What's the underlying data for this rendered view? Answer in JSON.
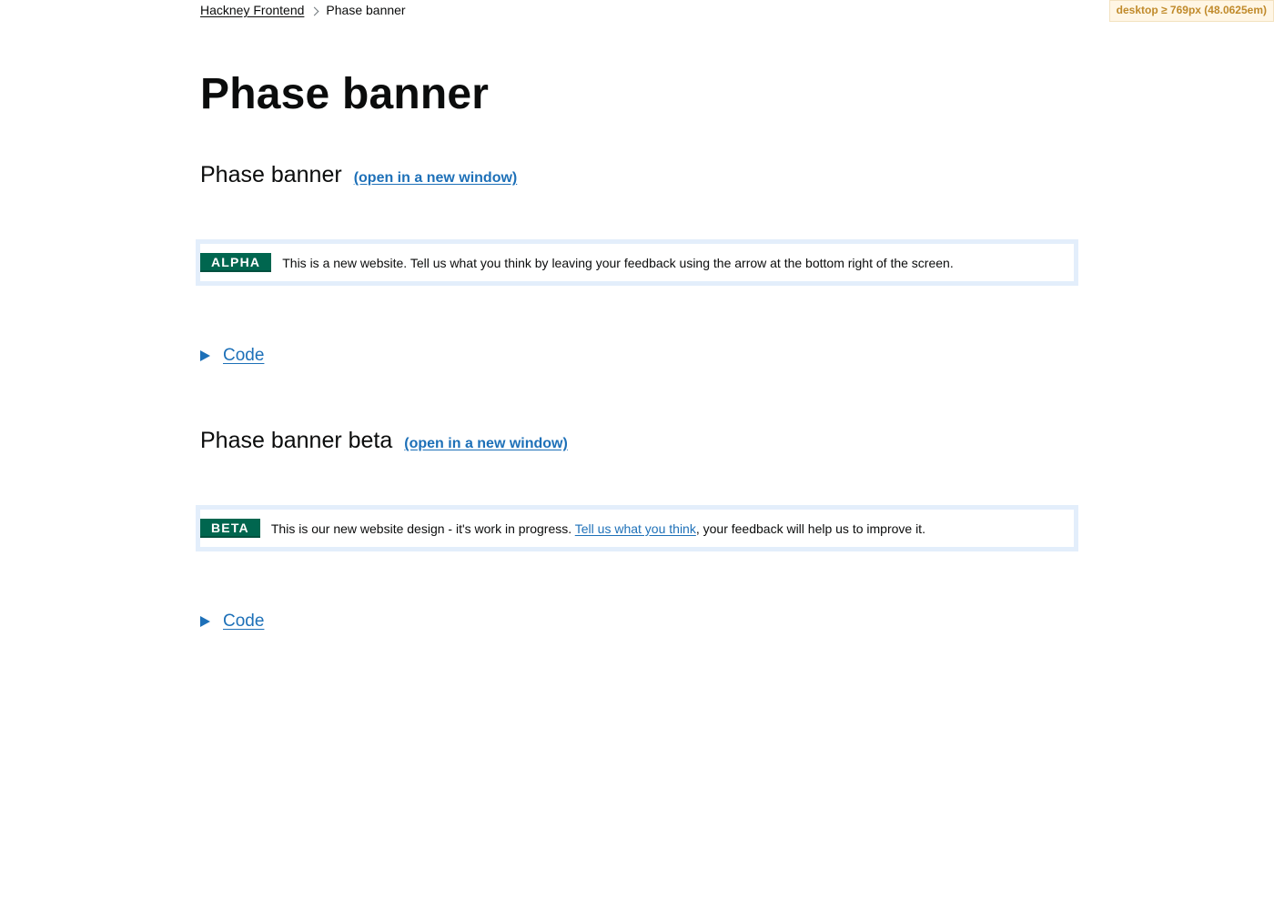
{
  "media_badge": "desktop ≥ 769px (48.0625em)",
  "breadcrumbs": {
    "home": "Hackney Frontend",
    "current": "Phase banner"
  },
  "page_title": "Phase banner",
  "examples": [
    {
      "heading": "Phase banner",
      "open_link": "(open in a new window)",
      "tag": "ALPHA",
      "text": "This is a new website. Tell us what you think by leaving your feedback using the arrow at the bottom right of the screen.",
      "code_summary": "Code"
    },
    {
      "heading": "Phase banner beta",
      "open_link": "(open in a new window)",
      "tag": "BETA",
      "text_before": "This is our new website design - it's work in progress. ",
      "link": "Tell us what you think",
      "text_after": ", your feedback will help us to improve it.",
      "code_summary": "Code"
    }
  ],
  "colors": {
    "link": "#1d70b8",
    "tag_bg": "#00664f",
    "frame": "#e3eefb"
  }
}
